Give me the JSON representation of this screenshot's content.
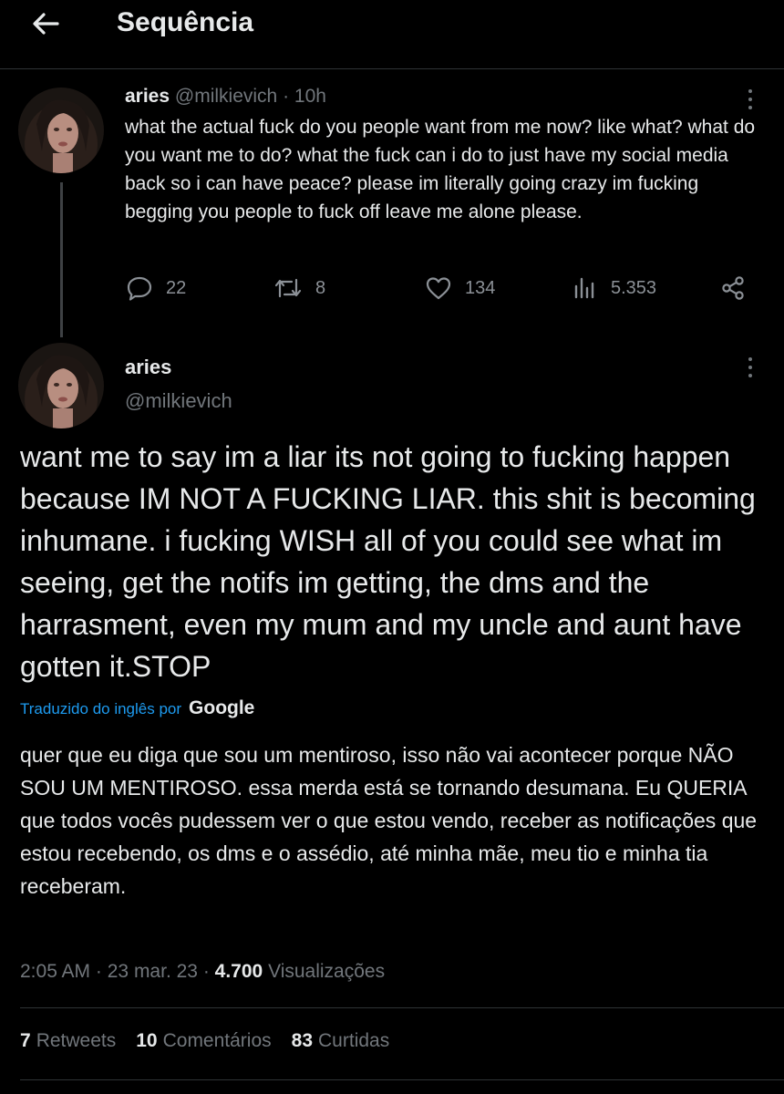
{
  "header": {
    "title": "Sequência"
  },
  "tweet1": {
    "name": "aries",
    "handle": "@milkievich",
    "separator": "·",
    "time": "10h",
    "text": "what the actual fuck do you people want from me now? like what? what do you want me to do? what the fuck can i do to just have my social media back so i can have peace? please im literally going crazy im fucking begging you people to fuck off leave me alone please.",
    "actions": {
      "replies": "22",
      "retweets": "8",
      "likes": "134",
      "views": "5.353"
    }
  },
  "tweet2": {
    "name": "aries",
    "handle": "@milkievich",
    "text": "want me to say im a liar its not going to fucking happen because IM NOT A FUCKING LIAR. this shit is becoming inhumane. i fucking WISH all of you could see what im seeing, get the notifs im getting, the dms and the harrasment, even my mum and my uncle and aunt have gotten it.STOP",
    "translated_label": "Traduzido do inglês por",
    "translated_provider": "Google",
    "translation": "quer que eu diga que sou um mentiroso, isso não vai acontecer porque NÃO SOU UM MENTIROSO. essa merda está se tornando desumana. Eu QUERIA que todos vocês pudessem ver o que estou vendo, receber as notificações que estou recebendo, os dms e o assédio, até minha mãe, meu tio e minha tia receberam.",
    "time": "2:05 AM",
    "sep1": "·",
    "date": "23 mar. 23",
    "sep2": "·",
    "views_count": "4.700",
    "views_label": "Visualizações",
    "stats": {
      "retweets_count": "7",
      "retweets_label": "Retweets",
      "comments_count": "10",
      "comments_label": "Comentários",
      "likes_count": "83",
      "likes_label": "Curtidas"
    }
  },
  "colors": {
    "background": "#000000",
    "text": "#e7e9ea",
    "muted": "#71767b",
    "link": "#1d9bf0",
    "divider": "#2f3336"
  },
  "icons": [
    "back-arrow-icon",
    "more-icon",
    "reply-icon",
    "retweet-icon",
    "like-icon",
    "views-icon",
    "share-icon"
  ]
}
